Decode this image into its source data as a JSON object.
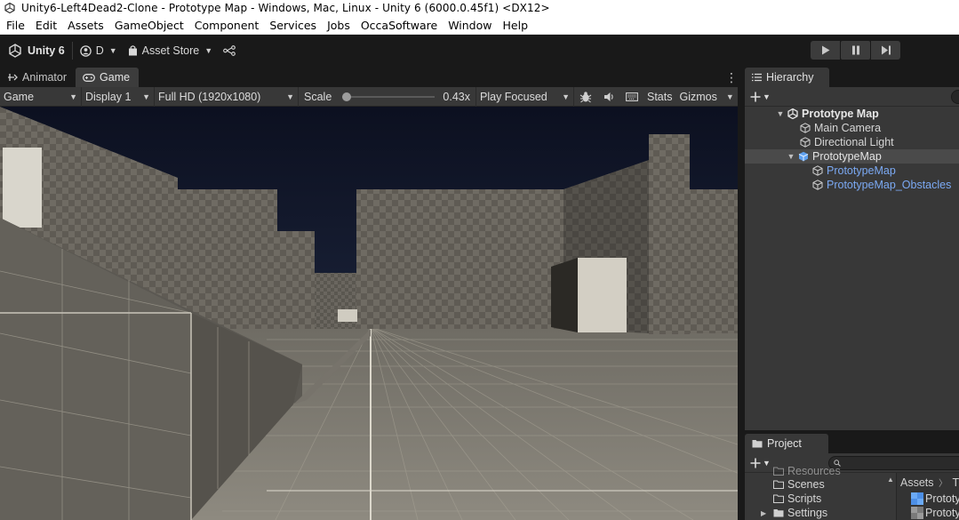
{
  "window": {
    "title": "Unity6-Left4Dead2-Clone - Prototype Map - Windows, Mac, Linux - Unity 6 (6000.0.45f1) <DX12>"
  },
  "menu": [
    "File",
    "Edit",
    "Assets",
    "GameObject",
    "Component",
    "Services",
    "Jobs",
    "OccaSoftware",
    "Window",
    "Help"
  ],
  "toolbar": {
    "account_label": "Unity 6",
    "user_label": "D",
    "asset_store_label": "Asset Store"
  },
  "game_panel": {
    "tabs": [
      {
        "label": "Animator",
        "icon": "animator-icon",
        "active": false
      },
      {
        "label": "Game",
        "icon": "gamepad-icon",
        "active": true
      }
    ],
    "view_mode": "Game",
    "display": "Display 1",
    "resolution": "Full HD (1920x1080)",
    "scale_label": "Scale",
    "scale_value": "0.43x",
    "scale_fraction": 0.43,
    "play_mode": "Play Focused",
    "stats_label": "Stats",
    "gizmos_label": "Gizmos"
  },
  "hierarchy": {
    "tab_label": "Hierarchy",
    "items": [
      {
        "label": "Prototype Map",
        "depth": 0,
        "type": "scene",
        "expanded": true
      },
      {
        "label": "Main Camera",
        "depth": 1,
        "type": "gameobject"
      },
      {
        "label": "Directional Light",
        "depth": 1,
        "type": "gameobject"
      },
      {
        "label": "PrototypeMap",
        "depth": 1,
        "type": "prefab-root",
        "expanded": true,
        "selected": true
      },
      {
        "label": "PrototypeMap",
        "depth": 2,
        "type": "prefab-child"
      },
      {
        "label": "PrototypeMap_Obstacles",
        "depth": 2,
        "type": "prefab-child"
      }
    ]
  },
  "project": {
    "tab_label": "Project",
    "folders": [
      {
        "label": "Resources"
      },
      {
        "label": "Scenes"
      },
      {
        "label": "Scripts"
      },
      {
        "label": "Settings"
      }
    ],
    "breadcrumb": [
      "Assets",
      "Th"
    ],
    "assets": [
      {
        "label": "Prototy"
      },
      {
        "label": "Prototy"
      }
    ]
  },
  "colors": {
    "prefab_blue": "#7ba9f3",
    "sky": "#0f1323",
    "panel": "#383838"
  }
}
